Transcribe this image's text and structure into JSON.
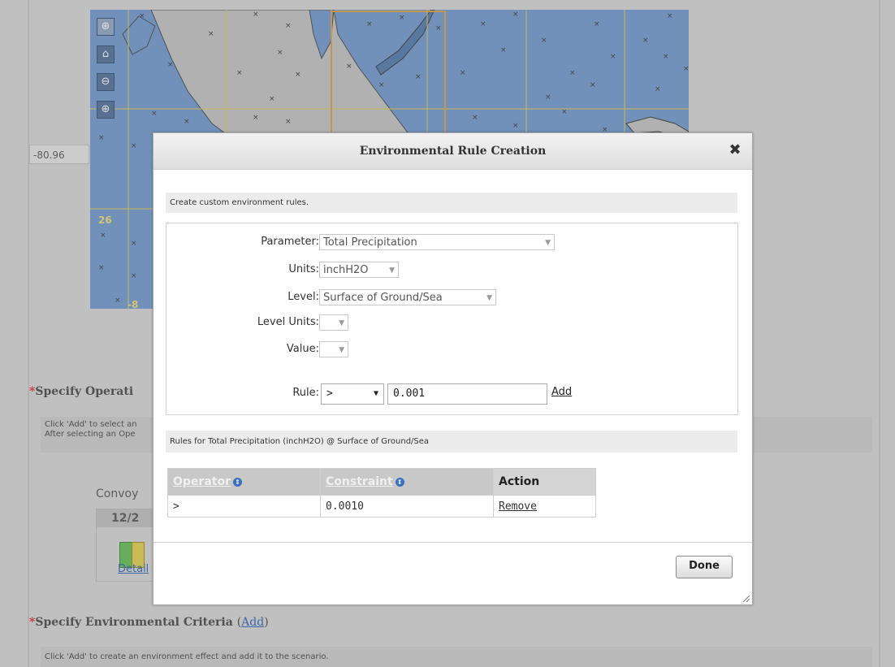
{
  "background": {
    "coordinate_value": "-80.96",
    "map": {
      "lat_label": "26",
      "lon_label": "-8",
      "tools": [
        "zoom-box-icon",
        "home-icon",
        "zoom-out-icon",
        "zoom-in-icon"
      ]
    },
    "operations_section": {
      "title": "Specify Operati",
      "info_line1": "Click 'Add' to select an",
      "info_line2": "After selecting an Ope"
    },
    "convoy": {
      "label": "Convoy",
      "date": "12/2",
      "details_link": "Detail"
    },
    "environmental_section": {
      "title": "Specify Environmental Criteria",
      "add_link": "Add",
      "open_paren": "(",
      "close_paren": ")",
      "info": "Click 'Add' to create an environment effect and add it to the scenario."
    }
  },
  "dialog": {
    "title": "Environmental Rule Creation",
    "close_glyph": "✖",
    "intro": "Create custom environment rules.",
    "fields": {
      "parameter_label": "Parameter:",
      "parameter_value": "Total Precipitation",
      "units_label": "Units:",
      "units_value": "inchH2O",
      "level_label": "Level:",
      "level_value": "Surface of Ground/Sea",
      "level_units_label": "Level Units:",
      "level_units_value": "",
      "value_label": "Value:",
      "value_value": ""
    },
    "rule": {
      "label": "Rule:",
      "operator": ">",
      "value": "0.001",
      "add_label": "Add"
    },
    "rules_caption": "Rules for Total Precipitation (inchH2O) @ Surface of Ground/Sea",
    "table": {
      "headers": [
        "Operator",
        "Constraint",
        "Action"
      ],
      "rows": [
        {
          "operator": ">",
          "constraint": "0.0010",
          "action": "Remove"
        }
      ]
    },
    "done_label": "Done"
  },
  "colors": {
    "map_water": "#6f9ad0",
    "map_land": "#c4c4c4",
    "grid_line": "#e3cc55",
    "required_marker": "#d22222",
    "link": "#2a62b5"
  }
}
